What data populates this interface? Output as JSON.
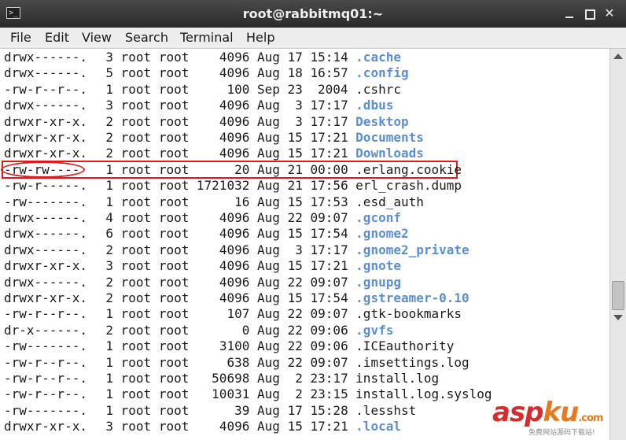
{
  "window": {
    "title": "root@rabbitmq01:~",
    "icon": "terminal-icon",
    "minimize_icon": "minimize-icon",
    "maximize_icon": "maximize-icon",
    "close_glyph": "✕"
  },
  "menu": [
    "File",
    "Edit",
    "View",
    "Search",
    "Terminal",
    "Help"
  ],
  "listing": [
    {
      "perm": "drwx------.",
      "links": "3",
      "user": "root",
      "group": "root",
      "size": "4096",
      "month": "Aug",
      "day": "17",
      "time": "15:14",
      "name": ".cache",
      "dir": true
    },
    {
      "perm": "drwx------.",
      "links": "5",
      "user": "root",
      "group": "root",
      "size": "4096",
      "month": "Aug",
      "day": "18",
      "time": "16:57",
      "name": ".config",
      "dir": true
    },
    {
      "perm": "-rw-r--r--.",
      "links": "1",
      "user": "root",
      "group": "root",
      "size": "100",
      "month": "Sep",
      "day": "23",
      "time": "2004",
      "name": ".cshrc",
      "dir": false
    },
    {
      "perm": "drwx------.",
      "links": "3",
      "user": "root",
      "group": "root",
      "size": "4096",
      "month": "Aug",
      "day": "3",
      "time": "17:17",
      "name": ".dbus",
      "dir": true
    },
    {
      "perm": "drwxr-xr-x.",
      "links": "2",
      "user": "root",
      "group": "root",
      "size": "4096",
      "month": "Aug",
      "day": "3",
      "time": "17:17",
      "name": "Desktop",
      "dir": true
    },
    {
      "perm": "drwxr-xr-x.",
      "links": "2",
      "user": "root",
      "group": "root",
      "size": "4096",
      "month": "Aug",
      "day": "15",
      "time": "17:21",
      "name": "Documents",
      "dir": true
    },
    {
      "perm": "drwxr-xr-x.",
      "links": "2",
      "user": "root",
      "group": "root",
      "size": "4096",
      "month": "Aug",
      "day": "15",
      "time": "17:21",
      "name": "Downloads",
      "dir": true
    },
    {
      "perm": "-rw-rw----",
      "links": "1",
      "user": "root",
      "group": "root",
      "size": "20",
      "month": "Aug",
      "day": "21",
      "time": "00:00",
      "name": ".erlang.cookie",
      "dir": false
    },
    {
      "perm": "-rw-r-----.",
      "links": "1",
      "user": "root",
      "group": "root",
      "size": "1721032",
      "month": "Aug",
      "day": "21",
      "time": "17:56",
      "name": "erl_crash.dump",
      "dir": false
    },
    {
      "perm": "-rw-------.",
      "links": "1",
      "user": "root",
      "group": "root",
      "size": "16",
      "month": "Aug",
      "day": "15",
      "time": "17:53",
      "name": ".esd_auth",
      "dir": false
    },
    {
      "perm": "drwx------.",
      "links": "4",
      "user": "root",
      "group": "root",
      "size": "4096",
      "month": "Aug",
      "day": "22",
      "time": "09:07",
      "name": ".gconf",
      "dir": true
    },
    {
      "perm": "drwx------.",
      "links": "6",
      "user": "root",
      "group": "root",
      "size": "4096",
      "month": "Aug",
      "day": "15",
      "time": "17:54",
      "name": ".gnome2",
      "dir": true
    },
    {
      "perm": "drwx------.",
      "links": "2",
      "user": "root",
      "group": "root",
      "size": "4096",
      "month": "Aug",
      "day": "3",
      "time": "17:17",
      "name": ".gnome2_private",
      "dir": true
    },
    {
      "perm": "drwxr-xr-x.",
      "links": "3",
      "user": "root",
      "group": "root",
      "size": "4096",
      "month": "Aug",
      "day": "15",
      "time": "17:21",
      "name": ".gnote",
      "dir": true
    },
    {
      "perm": "drwx------.",
      "links": "2",
      "user": "root",
      "group": "root",
      "size": "4096",
      "month": "Aug",
      "day": "22",
      "time": "09:07",
      "name": ".gnupg",
      "dir": true
    },
    {
      "perm": "drwxr-xr-x.",
      "links": "2",
      "user": "root",
      "group": "root",
      "size": "4096",
      "month": "Aug",
      "day": "15",
      "time": "17:54",
      "name": ".gstreamer-0.10",
      "dir": true
    },
    {
      "perm": "-rw-r--r--.",
      "links": "1",
      "user": "root",
      "group": "root",
      "size": "107",
      "month": "Aug",
      "day": "22",
      "time": "09:07",
      "name": ".gtk-bookmarks",
      "dir": false
    },
    {
      "perm": "dr-x------.",
      "links": "2",
      "user": "root",
      "group": "root",
      "size": "0",
      "month": "Aug",
      "day": "22",
      "time": "09:06",
      "name": ".gvfs",
      "dir": true
    },
    {
      "perm": "-rw-------.",
      "links": "1",
      "user": "root",
      "group": "root",
      "size": "3100",
      "month": "Aug",
      "day": "22",
      "time": "09:06",
      "name": ".ICEauthority",
      "dir": false
    },
    {
      "perm": "-rw-r--r--.",
      "links": "1",
      "user": "root",
      "group": "root",
      "size": "638",
      "month": "Aug",
      "day": "22",
      "time": "09:07",
      "name": ".imsettings.log",
      "dir": false
    },
    {
      "perm": "-rw-r--r--.",
      "links": "1",
      "user": "root",
      "group": "root",
      "size": "50698",
      "month": "Aug",
      "day": "2",
      "time": "23:17",
      "name": "install.log",
      "dir": false
    },
    {
      "perm": "-rw-r--r--.",
      "links": "1",
      "user": "root",
      "group": "root",
      "size": "10031",
      "month": "Aug",
      "day": "2",
      "time": "23:15",
      "name": "install.log.syslog",
      "dir": false
    },
    {
      "perm": "-rw-------.",
      "links": "1",
      "user": "root",
      "group": "root",
      "size": "39",
      "month": "Aug",
      "day": "17",
      "time": "15:28",
      "name": ".lesshst",
      "dir": false
    },
    {
      "perm": "drwxr-xr-x.",
      "links": "3",
      "user": "root",
      "group": "root",
      "size": "4096",
      "month": "Aug",
      "day": "15",
      "time": "17:21",
      "name": ".local",
      "dir": true
    }
  ],
  "colors": {
    "directory": "#5b8fd0",
    "highlight": "#e01919",
    "text": "#1a1a1a"
  },
  "watermark": {
    "logo_left": "asp",
    "logo_right": "ku",
    "logo_suffix": ".com",
    "subtitle": "免费网站源码下载站!"
  }
}
